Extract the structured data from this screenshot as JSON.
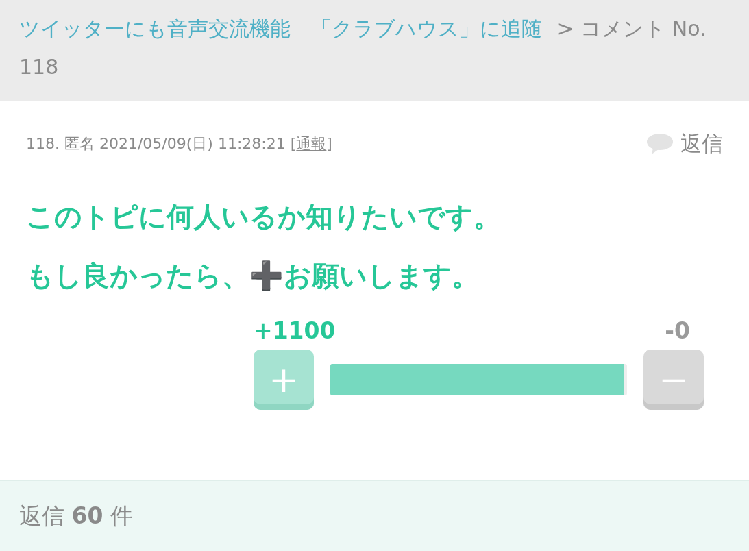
{
  "breadcrumb": {
    "link": "ツイッターにも音声交流機能　「クラブハウス」に追随",
    "separator": ">",
    "current": "コメント No. 118"
  },
  "comment": {
    "number": "118.",
    "author": "匿名",
    "date": "2021/05/09(日) 11:28:21",
    "report_open": "[",
    "report": "通報",
    "report_close": "]",
    "reply": "返信",
    "lines": [
      [
        {
          "kind": "text",
          "text": "このトピに何人いるか知りたいです。"
        }
      ],
      [
        {
          "kind": "text",
          "text": "もし良かったら、"
        },
        {
          "kind": "symbol",
          "text": "➕"
        },
        {
          "kind": "text",
          "text": "お願いします。"
        }
      ]
    ],
    "plus_count": "+1100",
    "minus_count": "-0",
    "plus_button": "+",
    "minus_button": "−",
    "level": 0.99
  },
  "footer": {
    "replies": "返信 **60** 件"
  }
}
